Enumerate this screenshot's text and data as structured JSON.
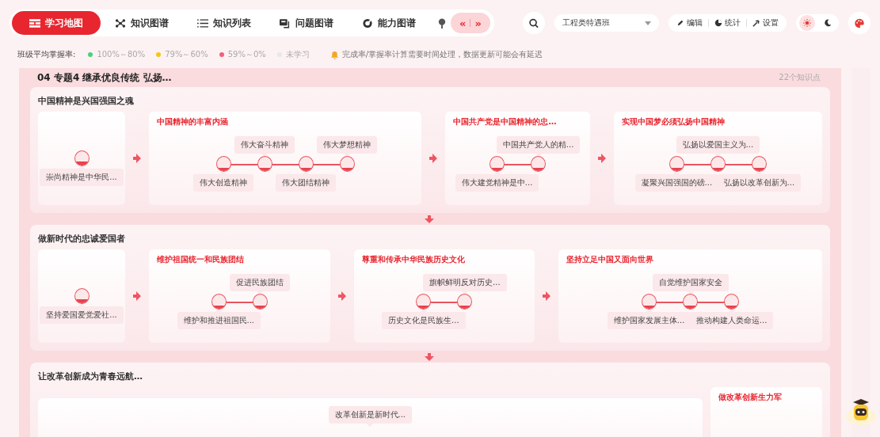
{
  "tabs": [
    {
      "label": "学习地图",
      "selected": true
    },
    {
      "label": "知识图谱",
      "selected": false
    },
    {
      "label": "知识列表",
      "selected": false
    },
    {
      "label": "问题图谱",
      "selected": false
    },
    {
      "label": "能力图谱",
      "selected": false
    }
  ],
  "scroll_buttons": [
    "«",
    "»"
  ],
  "class_select": {
    "value": "工程类特遇班"
  },
  "tools": [
    {
      "label": "编辑"
    },
    {
      "label": "统计"
    },
    {
      "label": "设置"
    }
  ],
  "theme": [
    {
      "kind": "sun",
      "selected": true
    },
    {
      "kind": "moon",
      "selected": false
    }
  ],
  "legend": {
    "label": "班级平均掌握率:",
    "items": [
      {
        "label": "100%～80%",
        "color": "#4cd07d"
      },
      {
        "label": "79%～60%",
        "color": "#f5c518"
      },
      {
        "label": "59%～0%",
        "color": "#f06277"
      },
      {
        "label": "未学习",
        "color": "#e8e8e8"
      }
    ]
  },
  "notice": "完成率/掌握率计算需要时间处理，数据更新可能会有延迟",
  "topic": {
    "title": "04 专题4 继承优良传统 弘扬…",
    "count": "22个知识点",
    "sections": [
      {
        "title": "中国精神是兴国强国之魂",
        "cards": [
          {
            "nodes": [
              {
                "label": "崇尚精神是中华民...",
                "level": 0.3,
                "label_above": false
              }
            ]
          },
          {
            "title": "中国精神的丰富内涵",
            "nodes": [
              {
                "label": "伟大创造精神",
                "level": 0.25,
                "label_above": false
              },
              {
                "label": "伟大奋斗精神",
                "level": 0.25,
                "label_above": true
              },
              {
                "label": "伟大团结精神",
                "level": 0.25,
                "label_above": false
              },
              {
                "label": "伟大梦想精神",
                "level": 0.25,
                "label_above": true
              }
            ]
          },
          {
            "title": "中国共产党是中国精神的忠…",
            "nodes": [
              {
                "label": "伟大建党精神是中...",
                "level": 0.25,
                "label_above": false
              },
              {
                "label": "中国共产党人的精...",
                "level": 0.25,
                "label_above": true
              }
            ]
          },
          {
            "title": "实现中国梦必须弘扬中国精神",
            "nodes": [
              {
                "label": "凝聚兴国强国的磅...",
                "level": 0.25,
                "label_above": false
              },
              {
                "label": "弘扬以爱国主义为...",
                "level": 0.25,
                "label_above": true
              },
              {
                "label": "弘扬以改革创新为...",
                "level": 0.25,
                "label_above": false
              }
            ]
          }
        ]
      },
      {
        "title": "做新时代的忠诚爱国者",
        "cards": [
          {
            "nodes": [
              {
                "label": "坚持爱国爱党爱社...",
                "level": 0.3,
                "label_above": false
              }
            ]
          },
          {
            "title": "维护祖国统一和民族团结",
            "nodes": [
              {
                "label": "维护和推进祖国民...",
                "level": 0.25,
                "label_above": false
              },
              {
                "label": "促进民族团结",
                "level": 0.25,
                "label_above": true
              }
            ]
          },
          {
            "title": "尊重和传承中华民族历史文化",
            "nodes": [
              {
                "label": "历史文化是民族生...",
                "level": 0.25,
                "label_above": false
              },
              {
                "label": "旗帜鲜明反对历史...",
                "level": 0.25,
                "label_above": true
              }
            ]
          },
          {
            "title": "坚持立足中国又面向世界",
            "nodes": [
              {
                "label": "维护国家发展主体...",
                "level": 0.25,
                "label_above": false
              },
              {
                "label": "自觉维护国家安全",
                "level": 0.25,
                "label_above": true
              },
              {
                "label": "推动构建人类命运...",
                "level": 0.25,
                "label_above": false
              }
            ]
          }
        ]
      },
      {
        "title": "让改革创新成为青春远航…",
        "cards": [
          {
            "nodes": [
              {
                "label": "改革创新是新时代...",
                "label_above": true
              }
            ]
          },
          {
            "title": "做改革创新生力军"
          }
        ]
      }
    ]
  }
}
